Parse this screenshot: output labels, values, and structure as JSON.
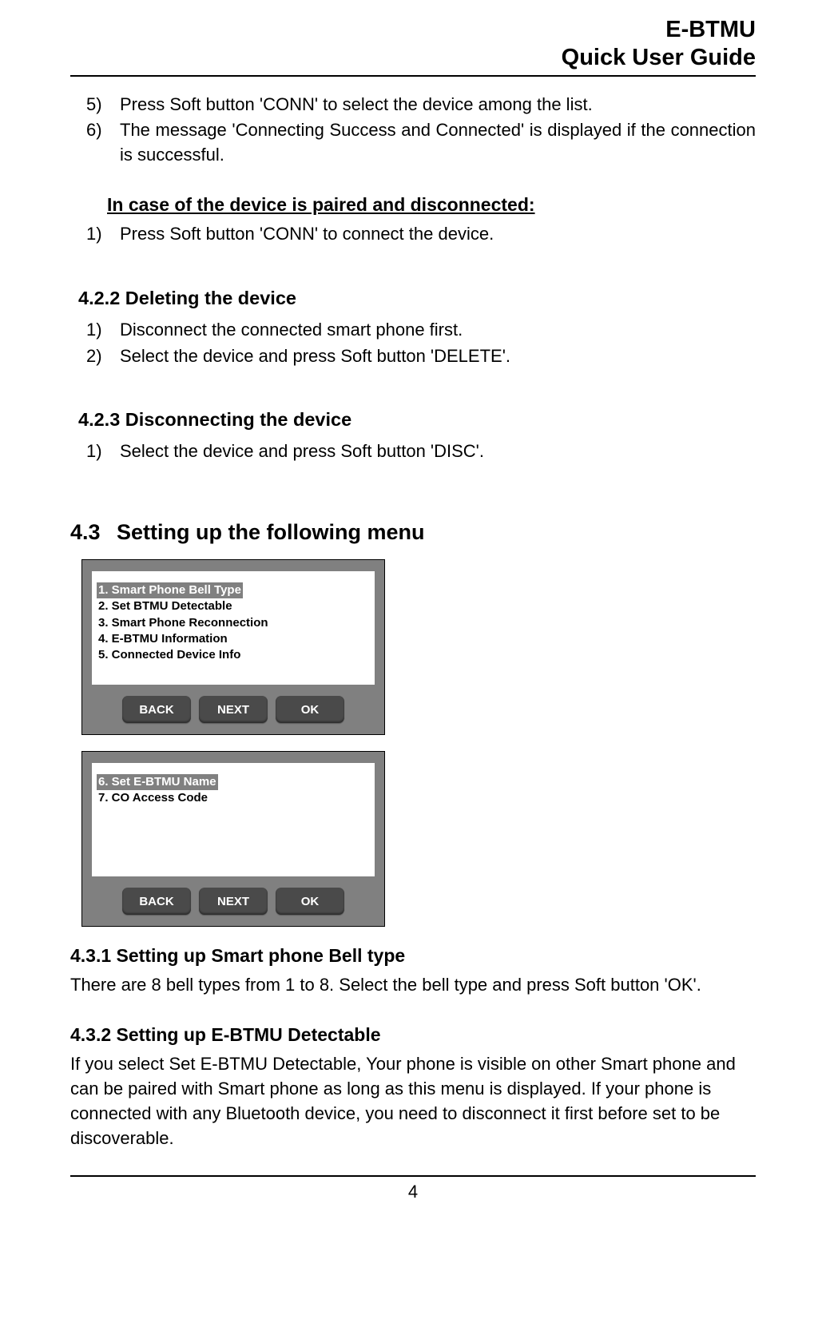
{
  "header": {
    "line1": "E-BTMU",
    "line2": "Quick User Guide"
  },
  "top_list": [
    {
      "n": "5)",
      "t": "Press Soft button 'CONN' to select the device among the list."
    },
    {
      "n": "6)",
      "t": "The message 'Connecting Success and Connected' is displayed if the connection is successful."
    }
  ],
  "case_heading": "In case of the device is paired and disconnected:",
  "case_list": [
    {
      "n": "1)",
      "t": "Press Soft button 'CONN' to connect the device."
    }
  ],
  "s422_title": "4.2.2 Deleting the device",
  "s422_list": [
    {
      "n": "1)",
      "t": "Disconnect the connected smart phone first."
    },
    {
      "n": "2)",
      "t": "Select the device and press Soft button 'DELETE'."
    }
  ],
  "s423_title": "4.2.3 Disconnecting the device",
  "s423_list": [
    {
      "n": "1)",
      "t": "Select the device and press Soft button 'DISC'."
    }
  ],
  "s43": {
    "num": "4.3",
    "title": "Setting up the following menu"
  },
  "screen1": {
    "items": [
      {
        "t": "1.  Smart Phone Bell Type",
        "sel": true
      },
      {
        "t": "2. Set BTMU Detectable",
        "sel": false
      },
      {
        "t": "3. Smart Phone Reconnection",
        "sel": false
      },
      {
        "t": "4. E-BTMU Information",
        "sel": false
      },
      {
        "t": "5. Connected Device Info",
        "sel": false
      }
    ],
    "keys": {
      "back": "BACK",
      "next": "NEXT",
      "ok": "OK"
    }
  },
  "screen2": {
    "items": [
      {
        "t": "6.  Set E-BTMU Name",
        "sel": true
      },
      {
        "t": "7. CO Access Code",
        "sel": false
      }
    ],
    "keys": {
      "back": "BACK",
      "next": "NEXT",
      "ok": "OK"
    }
  },
  "s431": {
    "title": "4.3.1 Setting up Smart phone Bell type",
    "body": "There are 8 bell types from 1 to 8. Select the bell type and press Soft button 'OK'."
  },
  "s432": {
    "title": "4.3.2 Setting up E-BTMU Detectable",
    "body": "If you select Set E-BTMU Detectable, Your phone is visible on other Smart phone and can be paired with Smart phone as long as this menu is displayed. If your phone is connected with any Bluetooth device, you need to disconnect it first before set to be discoverable."
  },
  "page_number": "4"
}
